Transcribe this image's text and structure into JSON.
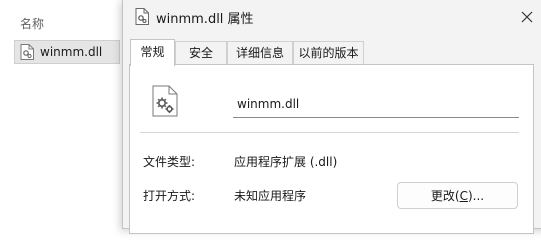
{
  "explorer": {
    "column_header": "名称",
    "file_name": "winmm.dll"
  },
  "dialog": {
    "title": "winmm.dll 属性",
    "tabs": [
      {
        "label": "常规",
        "active": true
      },
      {
        "label": "安全",
        "active": false
      },
      {
        "label": "详细信息",
        "active": false
      },
      {
        "label": "以前的版本",
        "active": false
      }
    ],
    "file_name_value": "winmm.dll",
    "file_type_label": "文件类型:",
    "file_type_value": "应用程序扩展 (.dll)",
    "open_with_label": "打开方式:",
    "open_with_value": "未知应用程序",
    "change_button": {
      "text": "更改(",
      "mnemonic": "C",
      "suffix": ")..."
    }
  }
}
